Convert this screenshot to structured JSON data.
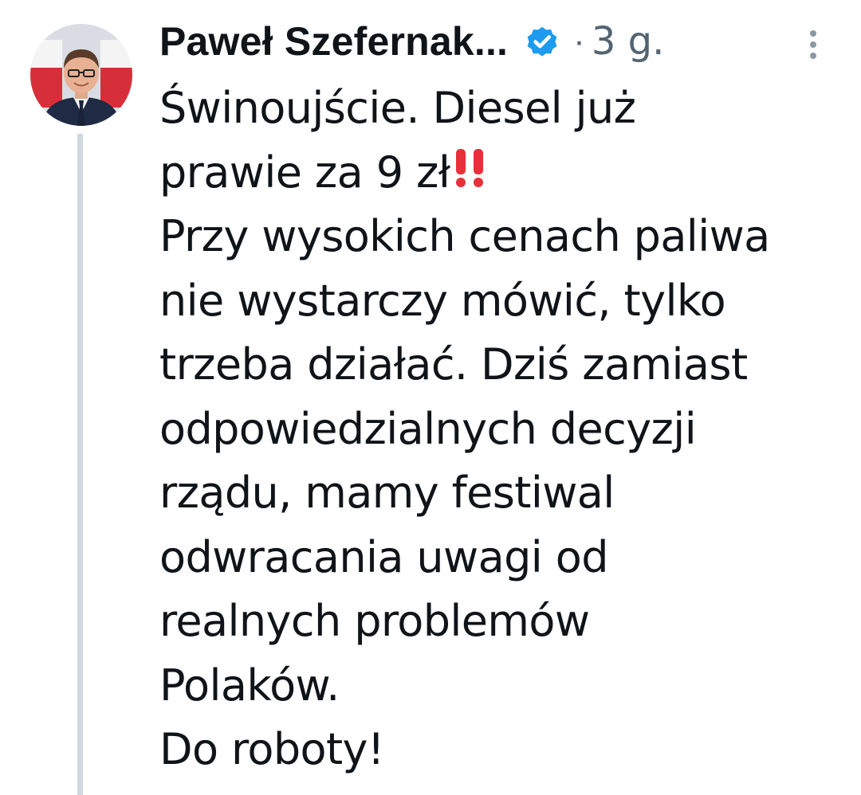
{
  "author": {
    "name": "Paweł Szefernak...",
    "verified_icon": "verified-badge-icon",
    "verified_color": "#1d9bf0"
  },
  "meta": {
    "separator": "·",
    "time": "3 g."
  },
  "menu": {
    "icon": "more-vertical-icon"
  },
  "text": {
    "line1": "Świnoujście. Diesel już",
    "line2": "prawie za 9 zł",
    "line2_emoji": "double-exclamation-icon",
    "line3": "Przy wysokich cenach paliwa",
    "line4": "nie wystarczy mówić, tylko",
    "line5": "trzeba działać. Dziś zamiast",
    "line6": "odpowiedzialnych decyzji",
    "line7": "rządu, mamy festiwal",
    "line8": "odwracania uwagi od",
    "line9": "realnych problemów",
    "line10": "Polaków.",
    "line11": "Do roboty!"
  },
  "colors": {
    "text": "#0f1419",
    "secondary": "#536471",
    "thread_line": "#cfd9de",
    "emoji_red": "#e8303a"
  }
}
